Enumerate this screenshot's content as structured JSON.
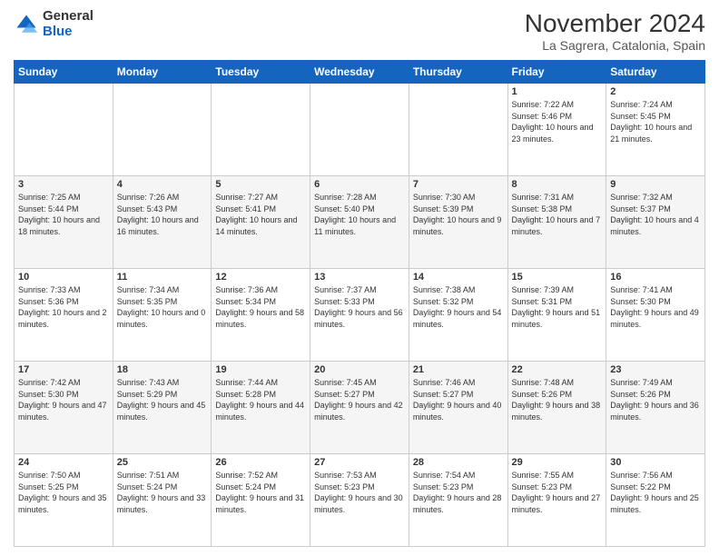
{
  "logo": {
    "general": "General",
    "blue": "Blue"
  },
  "title": "November 2024",
  "location": "La Sagrera, Catalonia, Spain",
  "weekdays": [
    "Sunday",
    "Monday",
    "Tuesday",
    "Wednesday",
    "Thursday",
    "Friday",
    "Saturday"
  ],
  "weeks": [
    [
      {
        "day": "",
        "info": ""
      },
      {
        "day": "",
        "info": ""
      },
      {
        "day": "",
        "info": ""
      },
      {
        "day": "",
        "info": ""
      },
      {
        "day": "",
        "info": ""
      },
      {
        "day": "1",
        "info": "Sunrise: 7:22 AM\nSunset: 5:46 PM\nDaylight: 10 hours and 23 minutes."
      },
      {
        "day": "2",
        "info": "Sunrise: 7:24 AM\nSunset: 5:45 PM\nDaylight: 10 hours and 21 minutes."
      }
    ],
    [
      {
        "day": "3",
        "info": "Sunrise: 7:25 AM\nSunset: 5:44 PM\nDaylight: 10 hours and 18 minutes."
      },
      {
        "day": "4",
        "info": "Sunrise: 7:26 AM\nSunset: 5:43 PM\nDaylight: 10 hours and 16 minutes."
      },
      {
        "day": "5",
        "info": "Sunrise: 7:27 AM\nSunset: 5:41 PM\nDaylight: 10 hours and 14 minutes."
      },
      {
        "day": "6",
        "info": "Sunrise: 7:28 AM\nSunset: 5:40 PM\nDaylight: 10 hours and 11 minutes."
      },
      {
        "day": "7",
        "info": "Sunrise: 7:30 AM\nSunset: 5:39 PM\nDaylight: 10 hours and 9 minutes."
      },
      {
        "day": "8",
        "info": "Sunrise: 7:31 AM\nSunset: 5:38 PM\nDaylight: 10 hours and 7 minutes."
      },
      {
        "day": "9",
        "info": "Sunrise: 7:32 AM\nSunset: 5:37 PM\nDaylight: 10 hours and 4 minutes."
      }
    ],
    [
      {
        "day": "10",
        "info": "Sunrise: 7:33 AM\nSunset: 5:36 PM\nDaylight: 10 hours and 2 minutes."
      },
      {
        "day": "11",
        "info": "Sunrise: 7:34 AM\nSunset: 5:35 PM\nDaylight: 10 hours and 0 minutes."
      },
      {
        "day": "12",
        "info": "Sunrise: 7:36 AM\nSunset: 5:34 PM\nDaylight: 9 hours and 58 minutes."
      },
      {
        "day": "13",
        "info": "Sunrise: 7:37 AM\nSunset: 5:33 PM\nDaylight: 9 hours and 56 minutes."
      },
      {
        "day": "14",
        "info": "Sunrise: 7:38 AM\nSunset: 5:32 PM\nDaylight: 9 hours and 54 minutes."
      },
      {
        "day": "15",
        "info": "Sunrise: 7:39 AM\nSunset: 5:31 PM\nDaylight: 9 hours and 51 minutes."
      },
      {
        "day": "16",
        "info": "Sunrise: 7:41 AM\nSunset: 5:30 PM\nDaylight: 9 hours and 49 minutes."
      }
    ],
    [
      {
        "day": "17",
        "info": "Sunrise: 7:42 AM\nSunset: 5:30 PM\nDaylight: 9 hours and 47 minutes."
      },
      {
        "day": "18",
        "info": "Sunrise: 7:43 AM\nSunset: 5:29 PM\nDaylight: 9 hours and 45 minutes."
      },
      {
        "day": "19",
        "info": "Sunrise: 7:44 AM\nSunset: 5:28 PM\nDaylight: 9 hours and 44 minutes."
      },
      {
        "day": "20",
        "info": "Sunrise: 7:45 AM\nSunset: 5:27 PM\nDaylight: 9 hours and 42 minutes."
      },
      {
        "day": "21",
        "info": "Sunrise: 7:46 AM\nSunset: 5:27 PM\nDaylight: 9 hours and 40 minutes."
      },
      {
        "day": "22",
        "info": "Sunrise: 7:48 AM\nSunset: 5:26 PM\nDaylight: 9 hours and 38 minutes."
      },
      {
        "day": "23",
        "info": "Sunrise: 7:49 AM\nSunset: 5:26 PM\nDaylight: 9 hours and 36 minutes."
      }
    ],
    [
      {
        "day": "24",
        "info": "Sunrise: 7:50 AM\nSunset: 5:25 PM\nDaylight: 9 hours and 35 minutes."
      },
      {
        "day": "25",
        "info": "Sunrise: 7:51 AM\nSunset: 5:24 PM\nDaylight: 9 hours and 33 minutes."
      },
      {
        "day": "26",
        "info": "Sunrise: 7:52 AM\nSunset: 5:24 PM\nDaylight: 9 hours and 31 minutes."
      },
      {
        "day": "27",
        "info": "Sunrise: 7:53 AM\nSunset: 5:23 PM\nDaylight: 9 hours and 30 minutes."
      },
      {
        "day": "28",
        "info": "Sunrise: 7:54 AM\nSunset: 5:23 PM\nDaylight: 9 hours and 28 minutes."
      },
      {
        "day": "29",
        "info": "Sunrise: 7:55 AM\nSunset: 5:23 PM\nDaylight: 9 hours and 27 minutes."
      },
      {
        "day": "30",
        "info": "Sunrise: 7:56 AM\nSunset: 5:22 PM\nDaylight: 9 hours and 25 minutes."
      }
    ]
  ]
}
